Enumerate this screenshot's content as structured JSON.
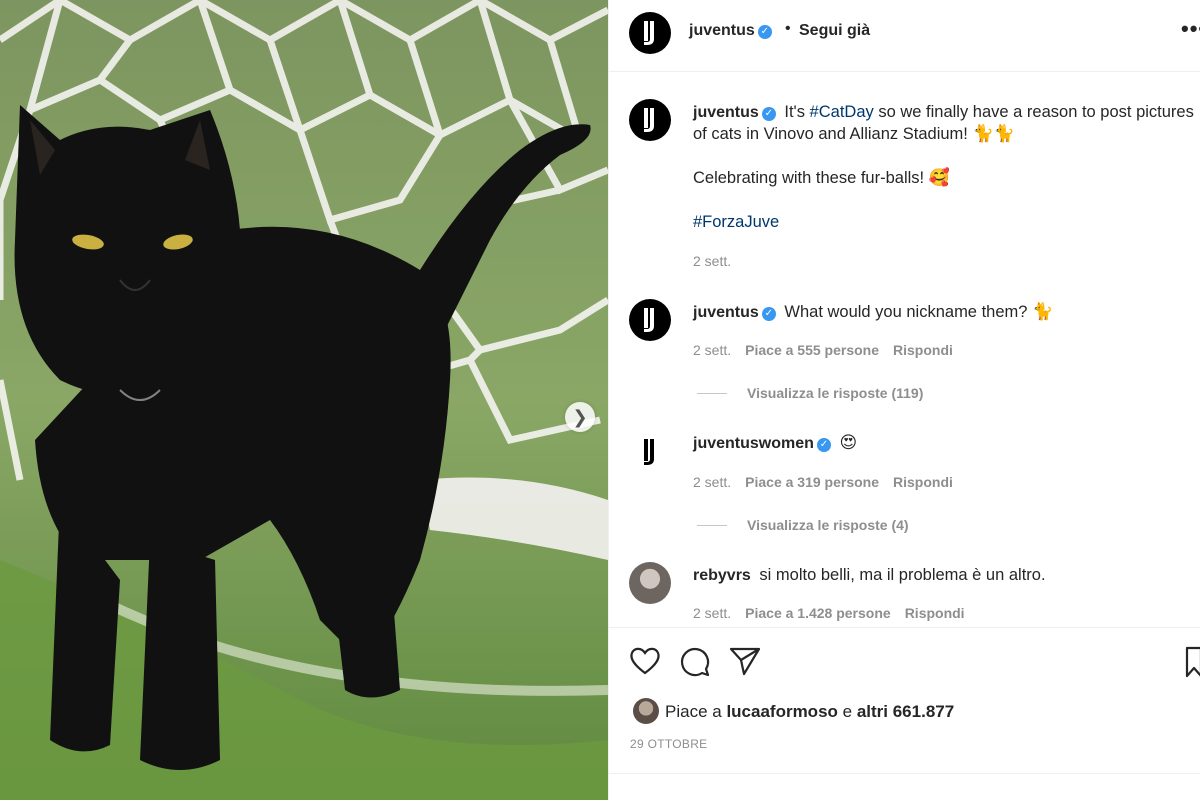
{
  "post": {
    "username": "juventus",
    "follow_status": "Segui già",
    "separator": "•",
    "more_label": "•••"
  },
  "caption": {
    "username": "juventus",
    "text_line1_before": "It's ",
    "hashtag1": "#CatDay",
    "text_line1_after": " so we finally have a reason to post pictures",
    "text_line2": "of cats in Vinovo and Allianz Stadium! ",
    "text_line2_emoji": "🐈🐈",
    "text_line3": "Celebrating with these fur-balls! ",
    "text_line3_emoji": "🥰",
    "hashtag2": "#ForzaJuve",
    "time": "2 sett."
  },
  "comments": [
    {
      "username": "juventus",
      "text": "What would you nickname them? ",
      "emoji": "🐈",
      "time": "2 sett.",
      "likes": "Piace a 555 persone",
      "reply": "Rispondi",
      "view_replies": "Visualizza le risposte (119)"
    },
    {
      "username": "juventuswomen",
      "text": "",
      "emoji": "😍",
      "time": "2 sett.",
      "likes": "Piace a 319 persone",
      "reply": "Rispondi",
      "view_replies": "Visualizza le risposte (4)"
    },
    {
      "username": "rebyvrs",
      "text": "si molto belli, ma il problema è un altro.",
      "time": "2 sett.",
      "likes": "Piace a 1.428 persone",
      "reply": "Rispondi"
    }
  ],
  "actions": {
    "likes_prefix": "Piace a ",
    "likes_user": "lucaaformoso",
    "likes_mid": " e ",
    "likes_others": "altri 661.877",
    "date": "29 OTTOBRE"
  },
  "icons": {
    "like": "heart-icon",
    "comment": "comment-icon",
    "share": "paper-plane-icon",
    "save": "bookmark-icon",
    "next": "chevron-right-icon",
    "verified": "verified-badge-icon"
  },
  "colors": {
    "verified": "#3897f0",
    "hashtag": "#00376b",
    "secondary": "#8e8e8e"
  }
}
